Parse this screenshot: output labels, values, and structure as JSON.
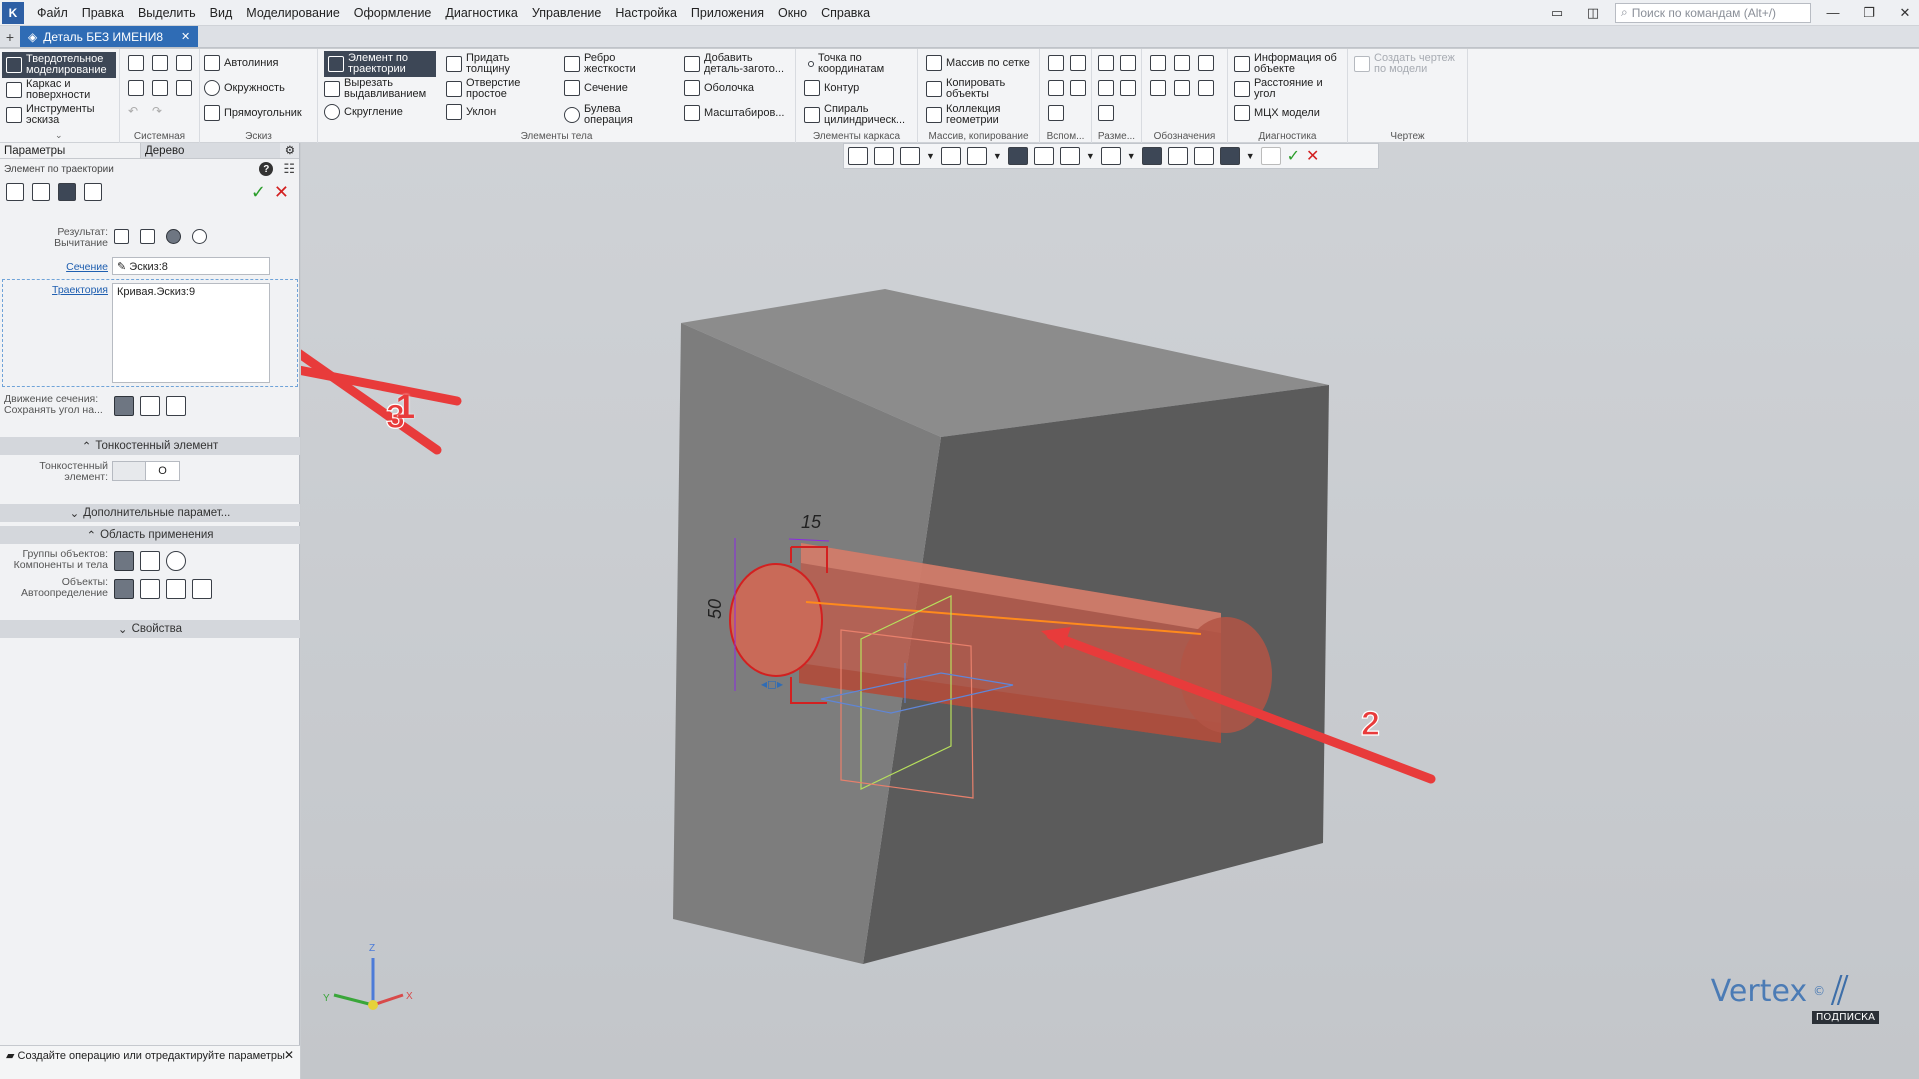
{
  "app": {
    "menu": [
      "Файл",
      "Правка",
      "Выделить",
      "Вид",
      "Моделирование",
      "Оформление",
      "Диагностика",
      "Управление",
      "Настройка",
      "Приложения",
      "Окно",
      "Справка"
    ],
    "search_placeholder": "Поиск по командам (Alt+/)",
    "document_tab": "Деталь БЕЗ ИМЕНИ8"
  },
  "ribbon": {
    "left_modes": [
      "Твердотельное моделирование",
      "Каркас и поверхности",
      "Инструменты эскиза"
    ],
    "system_label": "Системная",
    "sketch_items": [
      "Автолиния",
      "Окружность",
      "Прямоугольник"
    ],
    "sketch_label": "Эскиз",
    "body_items": [
      "Элемент по траектории",
      "Вырезать выдавливанием",
      "Скругление",
      "Придать толщину",
      "Отверстие простое",
      "Уклон",
      "Ребро жесткости",
      "Сечение",
      "Булева операция",
      "Добавить деталь-загото...",
      "Оболочка",
      "Масштабиров..."
    ],
    "body_label": "Элементы тела",
    "frame_items": [
      "Точка по координатам",
      "Контур",
      "Спираль цилиндрическ..."
    ],
    "frame_label": "Элементы каркаса",
    "array_items": [
      "Массив по сетке",
      "Копировать объекты",
      "Коллекция геометрии"
    ],
    "array_label": "Массив, копирование",
    "aux_label": "Вспом...",
    "size_label": "Разме...",
    "marks_label": "Обозначения",
    "diag_items": [
      "Информация об объекте",
      "Расстояние и угол",
      "МЦХ модели"
    ],
    "diag_label": "Диагностика",
    "drawing_items": [
      "Создать чертеж по модели"
    ],
    "drawing_label": "Чертеж"
  },
  "panel": {
    "tab_params": "Параметры",
    "tab_tree": "Дерево",
    "title": "Элемент по траектории",
    "result_label": "Результат:",
    "result_value": "Вычитание",
    "section_link": "Сечение",
    "section_value": "Эскиз:8",
    "path_link": "Траектория",
    "path_value": "Кривая.Эскиз:9",
    "motion_label1": "Движение сечения:",
    "motion_label2": "Сохранять угол на...",
    "thin_header": "Тонкостенный элемент",
    "thin_label1": "Тонкостенный",
    "thin_label2": "элемент:",
    "thin_toggle": "O",
    "extra_header": "Дополнительные парамет...",
    "scope_header": "Область применения",
    "groups_label1": "Группы объектов:",
    "groups_label2": "Компоненты и тела",
    "objects_label1": "Объекты:",
    "objects_label2": "Автоопределение",
    "props_header": "Свойства",
    "status_text": "Создайте операцию или отредактируйте параметры"
  },
  "viewport": {
    "dim_width": "15",
    "dim_height": "50",
    "callouts": [
      "1",
      "2",
      "3"
    ],
    "axis_z": "Z",
    "axis_x": "X",
    "axis_y": "Y",
    "watermark": "Vertex",
    "watermark_badge": "ПОДПИСКА"
  },
  "colors": {
    "accent_blue": "#2f6cb5",
    "callout_red": "#e83b3b",
    "cut_red": "#c45a48"
  }
}
